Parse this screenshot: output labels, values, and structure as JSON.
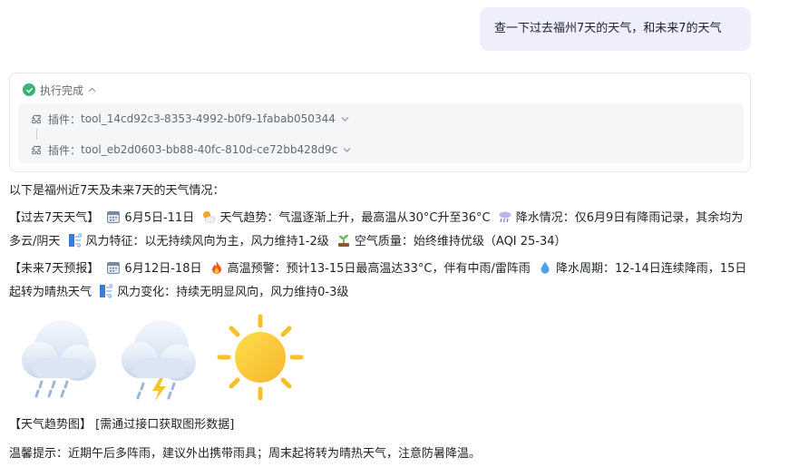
{
  "user_message": "查一下过去福州7天的天气，和未来7的天气",
  "execution": {
    "status": "执行完成",
    "tools": [
      {
        "prefix": "插件：",
        "id": "tool_14cd92c3-8353-4992-b0f9-1fabab050344"
      },
      {
        "prefix": "插件：",
        "id": "tool_eb2d0603-bb88-40fc-810d-ce72bb428d9c"
      }
    ]
  },
  "response": {
    "intro": "以下是福州近7天及未来7天的天气情况：",
    "past": {
      "heading": "【过去7天天气】",
      "dates": "6月5日-11日",
      "trend": "天气趋势：气温逐渐上升，最高温从30°C升至36°C",
      "rain": "降水情况：仅6月9日有降雨记录，其余均为多云/阴天",
      "wind": "风力特征：以无持续风向为主，风力维持1-2级",
      "air": "空气质量：始终维持优级（AQI 25-34）"
    },
    "future": {
      "heading": "【未来7天预报】",
      "dates": "6月12日-18日",
      "heat": "高温预警：预计13-15日最高温达33°C，伴有中雨/雷阵雨",
      "rain_period": "降水周期：12-14日连续降雨，15日起转为晴热天气",
      "wind": "风力变化：持续无明显风向，风力维持0-3级"
    },
    "weather_icons": [
      "rain-cloud",
      "thunderstorm-cloud",
      "sun"
    ],
    "trend_chart_text": "【天气趋势图】 [需通过接口获取图形数据]",
    "tip": "温馨提示：近期午后多阵雨，建议外出携带雨具；周末起将转为晴热天气，注意防暑降温。"
  },
  "colors": {
    "user_bubble": "#eeeefc",
    "success": "#3bb273",
    "muted_text": "#646a73",
    "tool_bg": "#f5f6f7"
  }
}
